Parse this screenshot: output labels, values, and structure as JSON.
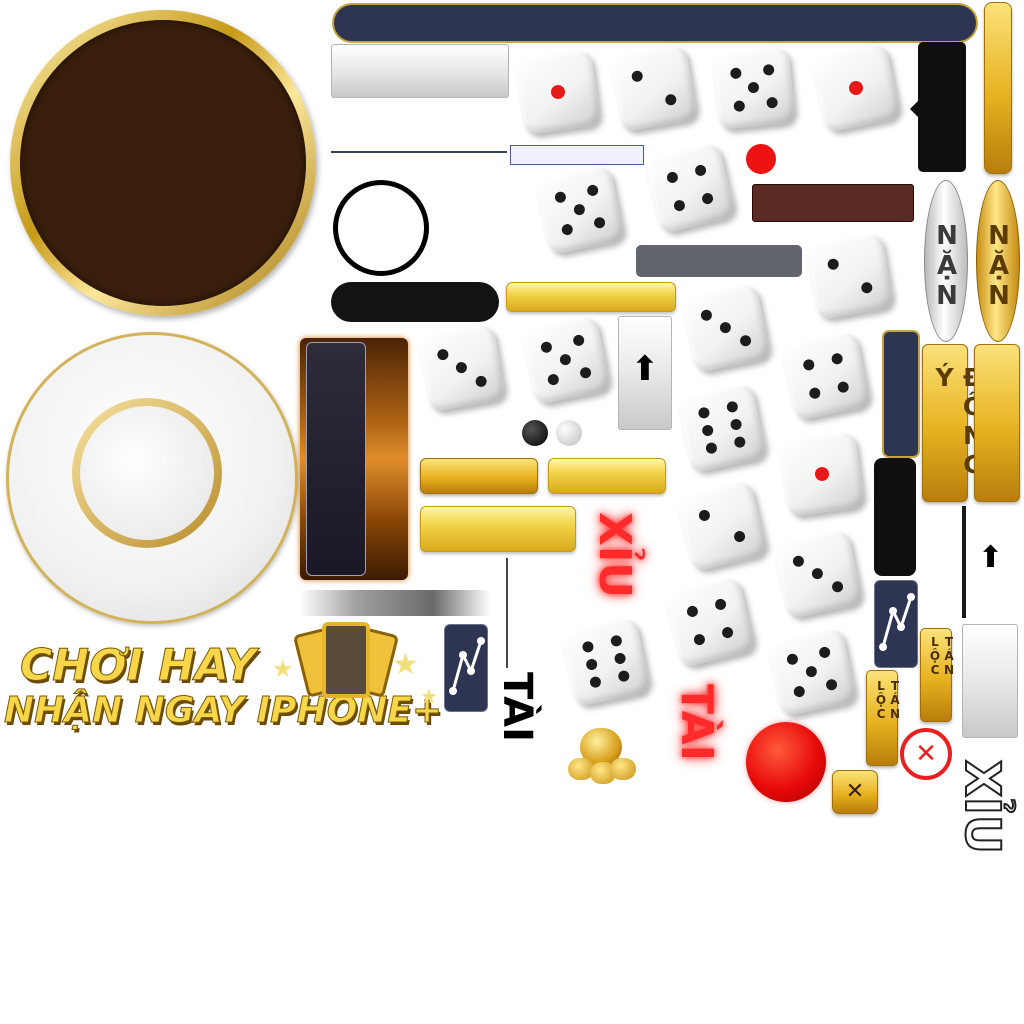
{
  "atlas": {
    "promo": {
      "line1": "CHƠI HAY",
      "line2": "NHẬN NGAY IPHONE+"
    },
    "labels": {
      "nan": "NẶN",
      "dong_y": "ĐỒNG Ý",
      "xiu": "XỈU",
      "tai": "TÀI",
      "tan_loc": "TÁN LỘC"
    },
    "icons": {
      "up_arrow": "⬆",
      "close_x": "✕",
      "stats": "stats-icon",
      "coins": "gold-coin-bag-icon",
      "phones": "phone-icon"
    },
    "colors": {
      "gold": "#e7b11f",
      "navy": "#2d3553",
      "red": "#e81818",
      "brown": "#3b1f0d",
      "dark": "#131313"
    }
  }
}
